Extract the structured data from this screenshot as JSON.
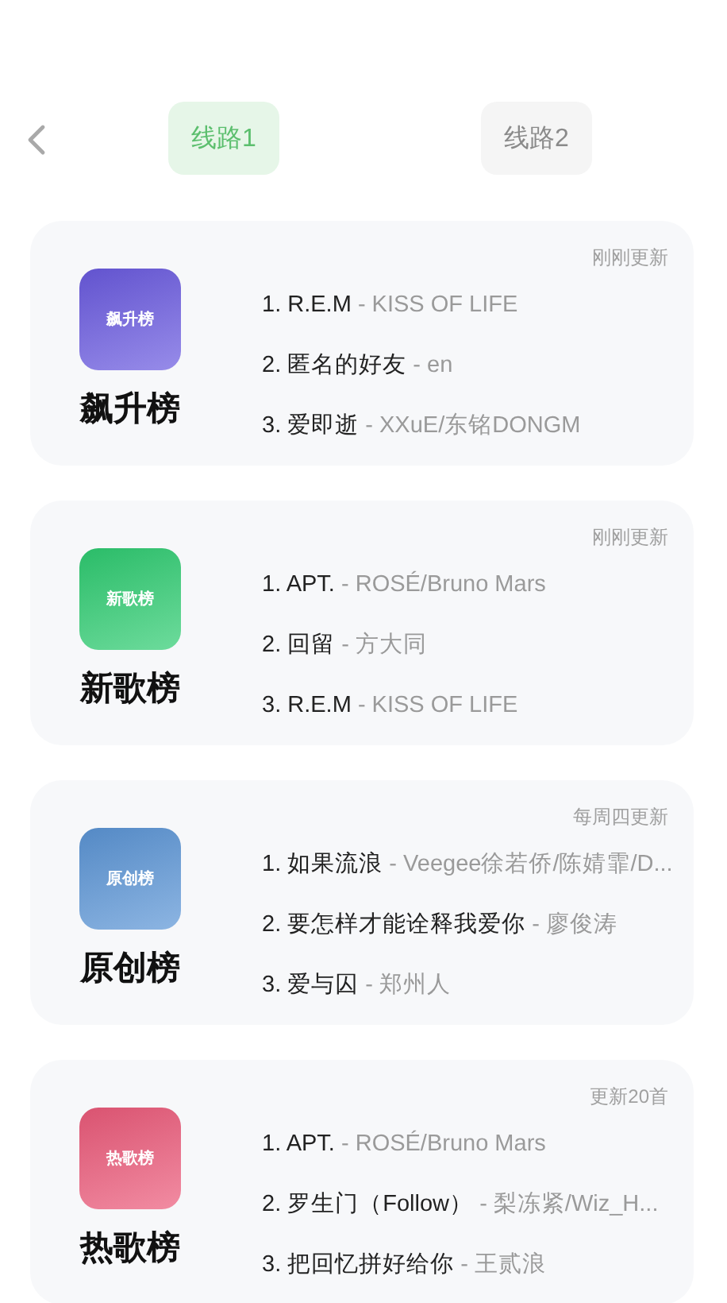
{
  "tabs": [
    {
      "label": "线路1",
      "selected": true
    },
    {
      "label": "线路2",
      "selected": false
    }
  ],
  "charts": [
    {
      "title": "飙升榜",
      "icon_label": "飙升榜",
      "color": "#6a5ae0",
      "update": "刚刚更新",
      "songs": [
        {
          "rank": "1.",
          "name": "R.E.M",
          "artist": "- KISS OF LIFE"
        },
        {
          "rank": "2.",
          "name": "匿名的好友",
          "artist": "- en"
        },
        {
          "rank": "3.",
          "name": "爱即逝",
          "artist": "- XXuE/东铭DONGM"
        }
      ]
    },
    {
      "title": "新歌榜",
      "icon_label": "新歌榜",
      "color": "#2ecc71",
      "update": "刚刚更新",
      "songs": [
        {
          "rank": "1.",
          "name": "APT.",
          "artist": "- ROSÉ/Bruno Mars"
        },
        {
          "rank": "2.",
          "name": "回留",
          "artist": "- 方大同"
        },
        {
          "rank": "3.",
          "name": "R.E.M",
          "artist": "- KISS OF LIFE"
        }
      ]
    },
    {
      "title": "原创榜",
      "icon_label": "原创榜",
      "color": "#5b95d6",
      "update": "每周四更新",
      "songs": [
        {
          "rank": "1.",
          "name": "如果流浪",
          "artist": "- Veegee徐若侨/陈婧霏/D..."
        },
        {
          "rank": "2.",
          "name": "要怎样才能诠释我爱你",
          "artist": "- 廖俊涛"
        },
        {
          "rank": "3.",
          "name": "爱与囚",
          "artist": "- 郑州人"
        }
      ]
    },
    {
      "title": "热歌榜",
      "icon_label": "热歌榜",
      "color": "#ec5a7a",
      "update": "更新20首",
      "songs": [
        {
          "rank": "1.",
          "name": "APT.",
          "artist": "- ROSÉ/Bruno Mars"
        },
        {
          "rank": "2.",
          "name": "罗生门（Follow）",
          "artist": "- 梨冻紧/Wiz_H..."
        },
        {
          "rank": "3.",
          "name": "把回忆拼好给你",
          "artist": "- 王贰浪"
        }
      ]
    }
  ]
}
